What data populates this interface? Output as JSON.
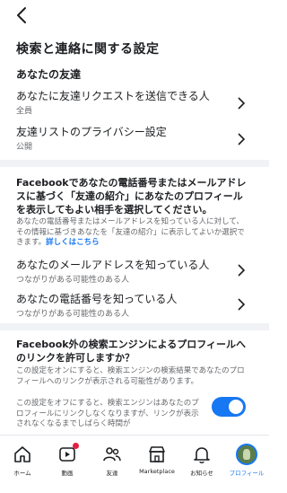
{
  "header": {
    "back_icon": "back-arrow-icon"
  },
  "page_title": "検索と連絡に関する設定",
  "friends": {
    "title": "あなたの友達",
    "rows": [
      {
        "label": "あなたに友達リクエストを送信できる人",
        "sub": "全員"
      },
      {
        "label": "友達リストのプライバシー設定",
        "sub": "公開"
      }
    ]
  },
  "suggest": {
    "title": "Facebookであなたの電話番号またはメールアドレスに基づく「友達の紹介」にあなたのプロフィールを表示してもよい相手を選択してください。",
    "desc": "あなたの電話番号またはメールアドレスを知っている人に対して、その情報に基づきあなたを「友達の紹介」に表示してよいか選択できます。",
    "link": "詳しくはこちら",
    "rows": [
      {
        "label": "あなたのメールアドレスを知っている人",
        "sub": "つながりがある可能性のある人"
      },
      {
        "label": "あなたの電話番号を知っている人",
        "sub": "つながりがある可能性のある人"
      }
    ]
  },
  "search_engines": {
    "title": "Facebook外の検索エンジンによるプロフィールへのリンクを許可しますか？",
    "desc_on": "この設定をオンにすると、検索エンジンの検索結果であなたのプロフィールへのリンクが表示される可能性があります。",
    "desc_off": "この設定をオフにすると、検索エンジンはあなたのプロフィールにリンクしなくなりますが、リンクが表示されなくなるまでしばらく時間が",
    "toggle_on": true
  },
  "tabbar": [
    {
      "label": "ホーム",
      "icon": "home-icon"
    },
    {
      "label": "動画",
      "icon": "video-icon",
      "badge": true
    },
    {
      "label": "友達",
      "icon": "friends-icon"
    },
    {
      "label": "Marketplace",
      "icon": "marketplace-icon"
    },
    {
      "label": "お知らせ",
      "icon": "bell-icon"
    },
    {
      "label": "プロフィール",
      "icon": "profile-avatar",
      "active": true
    }
  ],
  "colors": {
    "accent": "#1877f2",
    "badge": "#e41e3f",
    "text": "#1c1e21",
    "secondary": "#65676b"
  }
}
